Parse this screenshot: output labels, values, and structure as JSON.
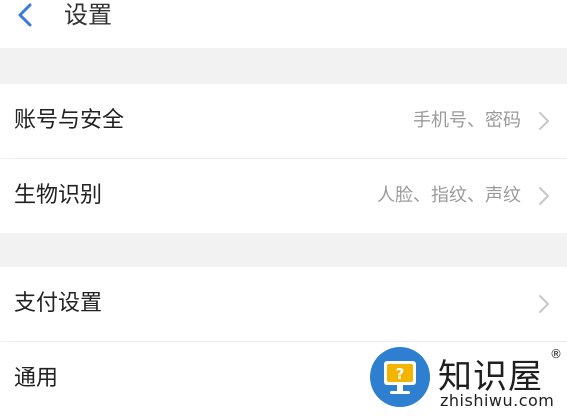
{
  "header": {
    "title": "设置",
    "back_icon": "chevron-left-icon",
    "accent": "#3b7bd8"
  },
  "groups": [
    [
      {
        "label": "账号与安全",
        "value": "手机号、密码"
      },
      {
        "label": "生物识别",
        "value": "人脸、指纹、声纹"
      }
    ],
    [
      {
        "label": "支付设置",
        "value": ""
      },
      {
        "label": "通用",
        "value": ""
      }
    ]
  ],
  "watermark": {
    "cn": "知识屋",
    "en": "zhishiwu.com",
    "reg": "®"
  }
}
